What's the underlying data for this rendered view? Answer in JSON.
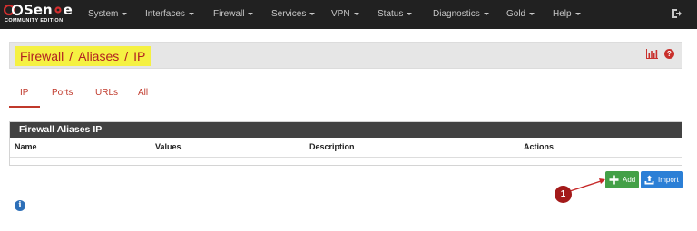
{
  "brand": {
    "name_part1": "Sen",
    "name_part2": "e",
    "edition": "COMMUNITY EDITION"
  },
  "nav": {
    "items": [
      {
        "label": "System"
      },
      {
        "label": "Interfaces"
      },
      {
        "label": "Firewall"
      },
      {
        "label": "Services"
      },
      {
        "label": "VPN"
      },
      {
        "label": "Status"
      },
      {
        "label": "Diagnostics"
      },
      {
        "label": "Gold"
      },
      {
        "label": "Help"
      }
    ],
    "logout_icon": "logout-icon"
  },
  "breadcrumb": {
    "items": [
      "Firewall",
      "Aliases",
      "IP"
    ],
    "separator": "/",
    "highlight_color": "#f5f142"
  },
  "tabs": [
    {
      "label": "IP",
      "active": true
    },
    {
      "label": "Ports",
      "active": false
    },
    {
      "label": "URLs",
      "active": false
    },
    {
      "label": "All",
      "active": false
    }
  ],
  "panel": {
    "title": "Firewall Aliases IP",
    "columns": [
      "Name",
      "Values",
      "Description",
      "Actions"
    ],
    "rows": []
  },
  "buttons": {
    "add_label": "Add",
    "import_label": "Import"
  },
  "annotation": {
    "number": "1",
    "color": "#a31a1a"
  },
  "colors": {
    "navbar": "#212121",
    "accent_red": "#c0392b",
    "add_green": "#43a047",
    "import_blue": "#2b7fd6",
    "panel_header": "#424242"
  }
}
